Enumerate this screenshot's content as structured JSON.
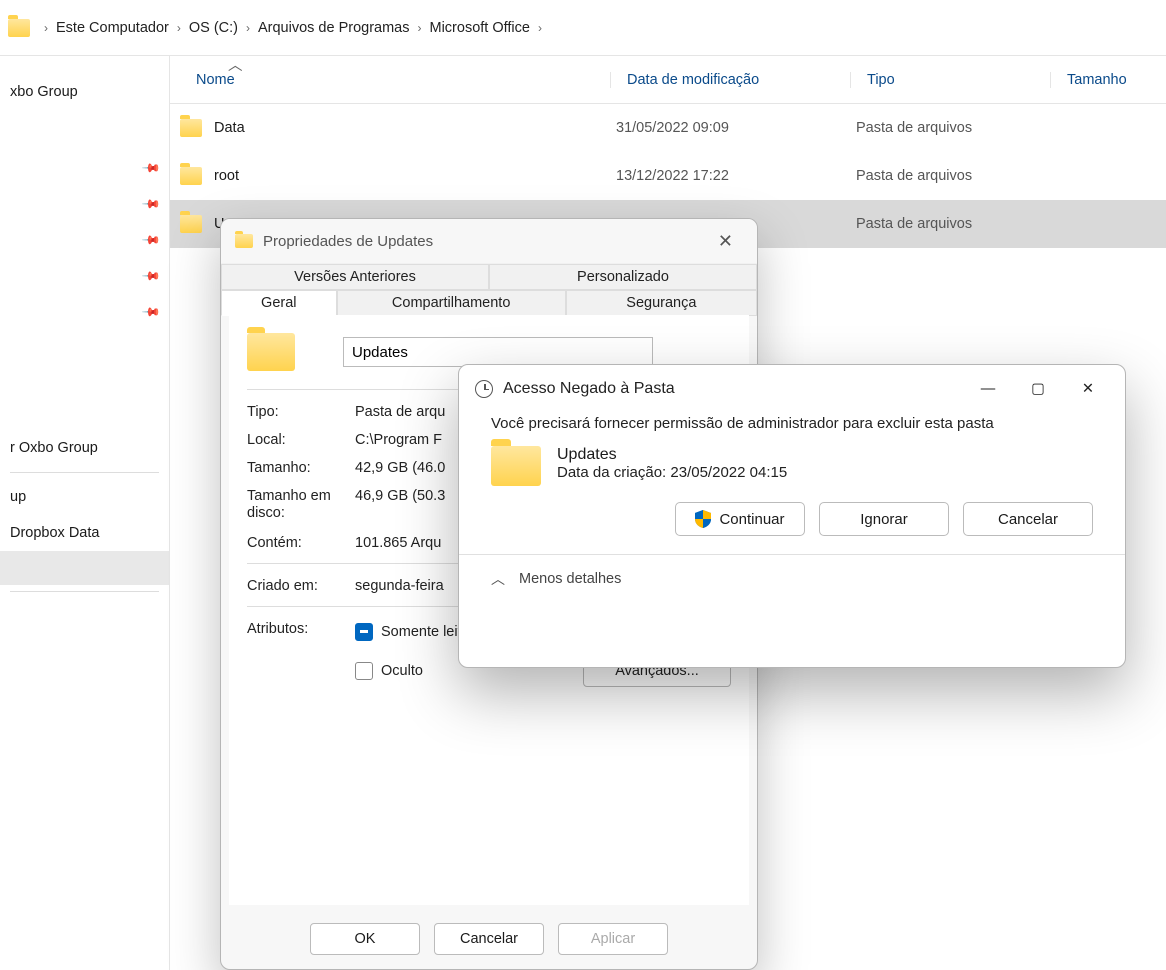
{
  "breadcrumb": [
    "Este Computador",
    "OS (C:)",
    "Arquivos de Programas",
    "Microsoft Office"
  ],
  "columns": {
    "name": "Nome",
    "date": "Data de modificação",
    "type": "Tipo",
    "size": "Tamanho"
  },
  "files": [
    {
      "name": "Data",
      "date": "31/05/2022 09:09",
      "type": "Pasta de arquivos"
    },
    {
      "name": "root",
      "date": "13/12/2022 17:22",
      "type": "Pasta de arquivos"
    },
    {
      "name": "U",
      "date": "",
      "type": "Pasta de arquivos"
    }
  ],
  "sidebar": {
    "top": "xbo Group",
    "quick": [
      "",
      "",
      "",
      "",
      ""
    ],
    "bottom": [
      "r Oxbo Group",
      "up",
      "Dropbox Data"
    ]
  },
  "props": {
    "title": "Propriedades de Updates",
    "tabs_top": [
      "Versões Anteriores",
      "Personalizado"
    ],
    "tabs_bottom": [
      "Geral",
      "Compartilhamento",
      "Segurança"
    ],
    "name_value": "Updates",
    "fields": {
      "tipo_k": "Tipo:",
      "tipo_v": "Pasta de arqu",
      "local_k": "Local:",
      "local_v": "C:\\Program F",
      "tam_k": "Tamanho:",
      "tam_v": "42,9 GB (46.0",
      "tamd_k": "Tamanho em disco:",
      "tamd_v": "46,9 GB (50.3",
      "cont_k": "Contém:",
      "cont_v": "101.865 Arqu",
      "criado_k": "Criado em:",
      "criado_v": "segunda-feira",
      "attr_k": "Atributos:",
      "ro_label": "Somente leitura (arquivos da pasta)",
      "hidden_label": "Oculto",
      "adv": "Avançados..."
    },
    "buttons": {
      "ok": "OK",
      "cancel": "Cancelar",
      "apply": "Aplicar"
    }
  },
  "uac": {
    "title": "Acesso Negado à Pasta",
    "msg": "Você precisará fornecer permissão de administrador para excluir esta pasta",
    "item_name": "Updates",
    "item_date": "Data da criação: 23/05/2022 04:15",
    "continue": "Continuar",
    "ignore": "Ignorar",
    "cancel": "Cancelar",
    "less": "Menos detalhes"
  }
}
